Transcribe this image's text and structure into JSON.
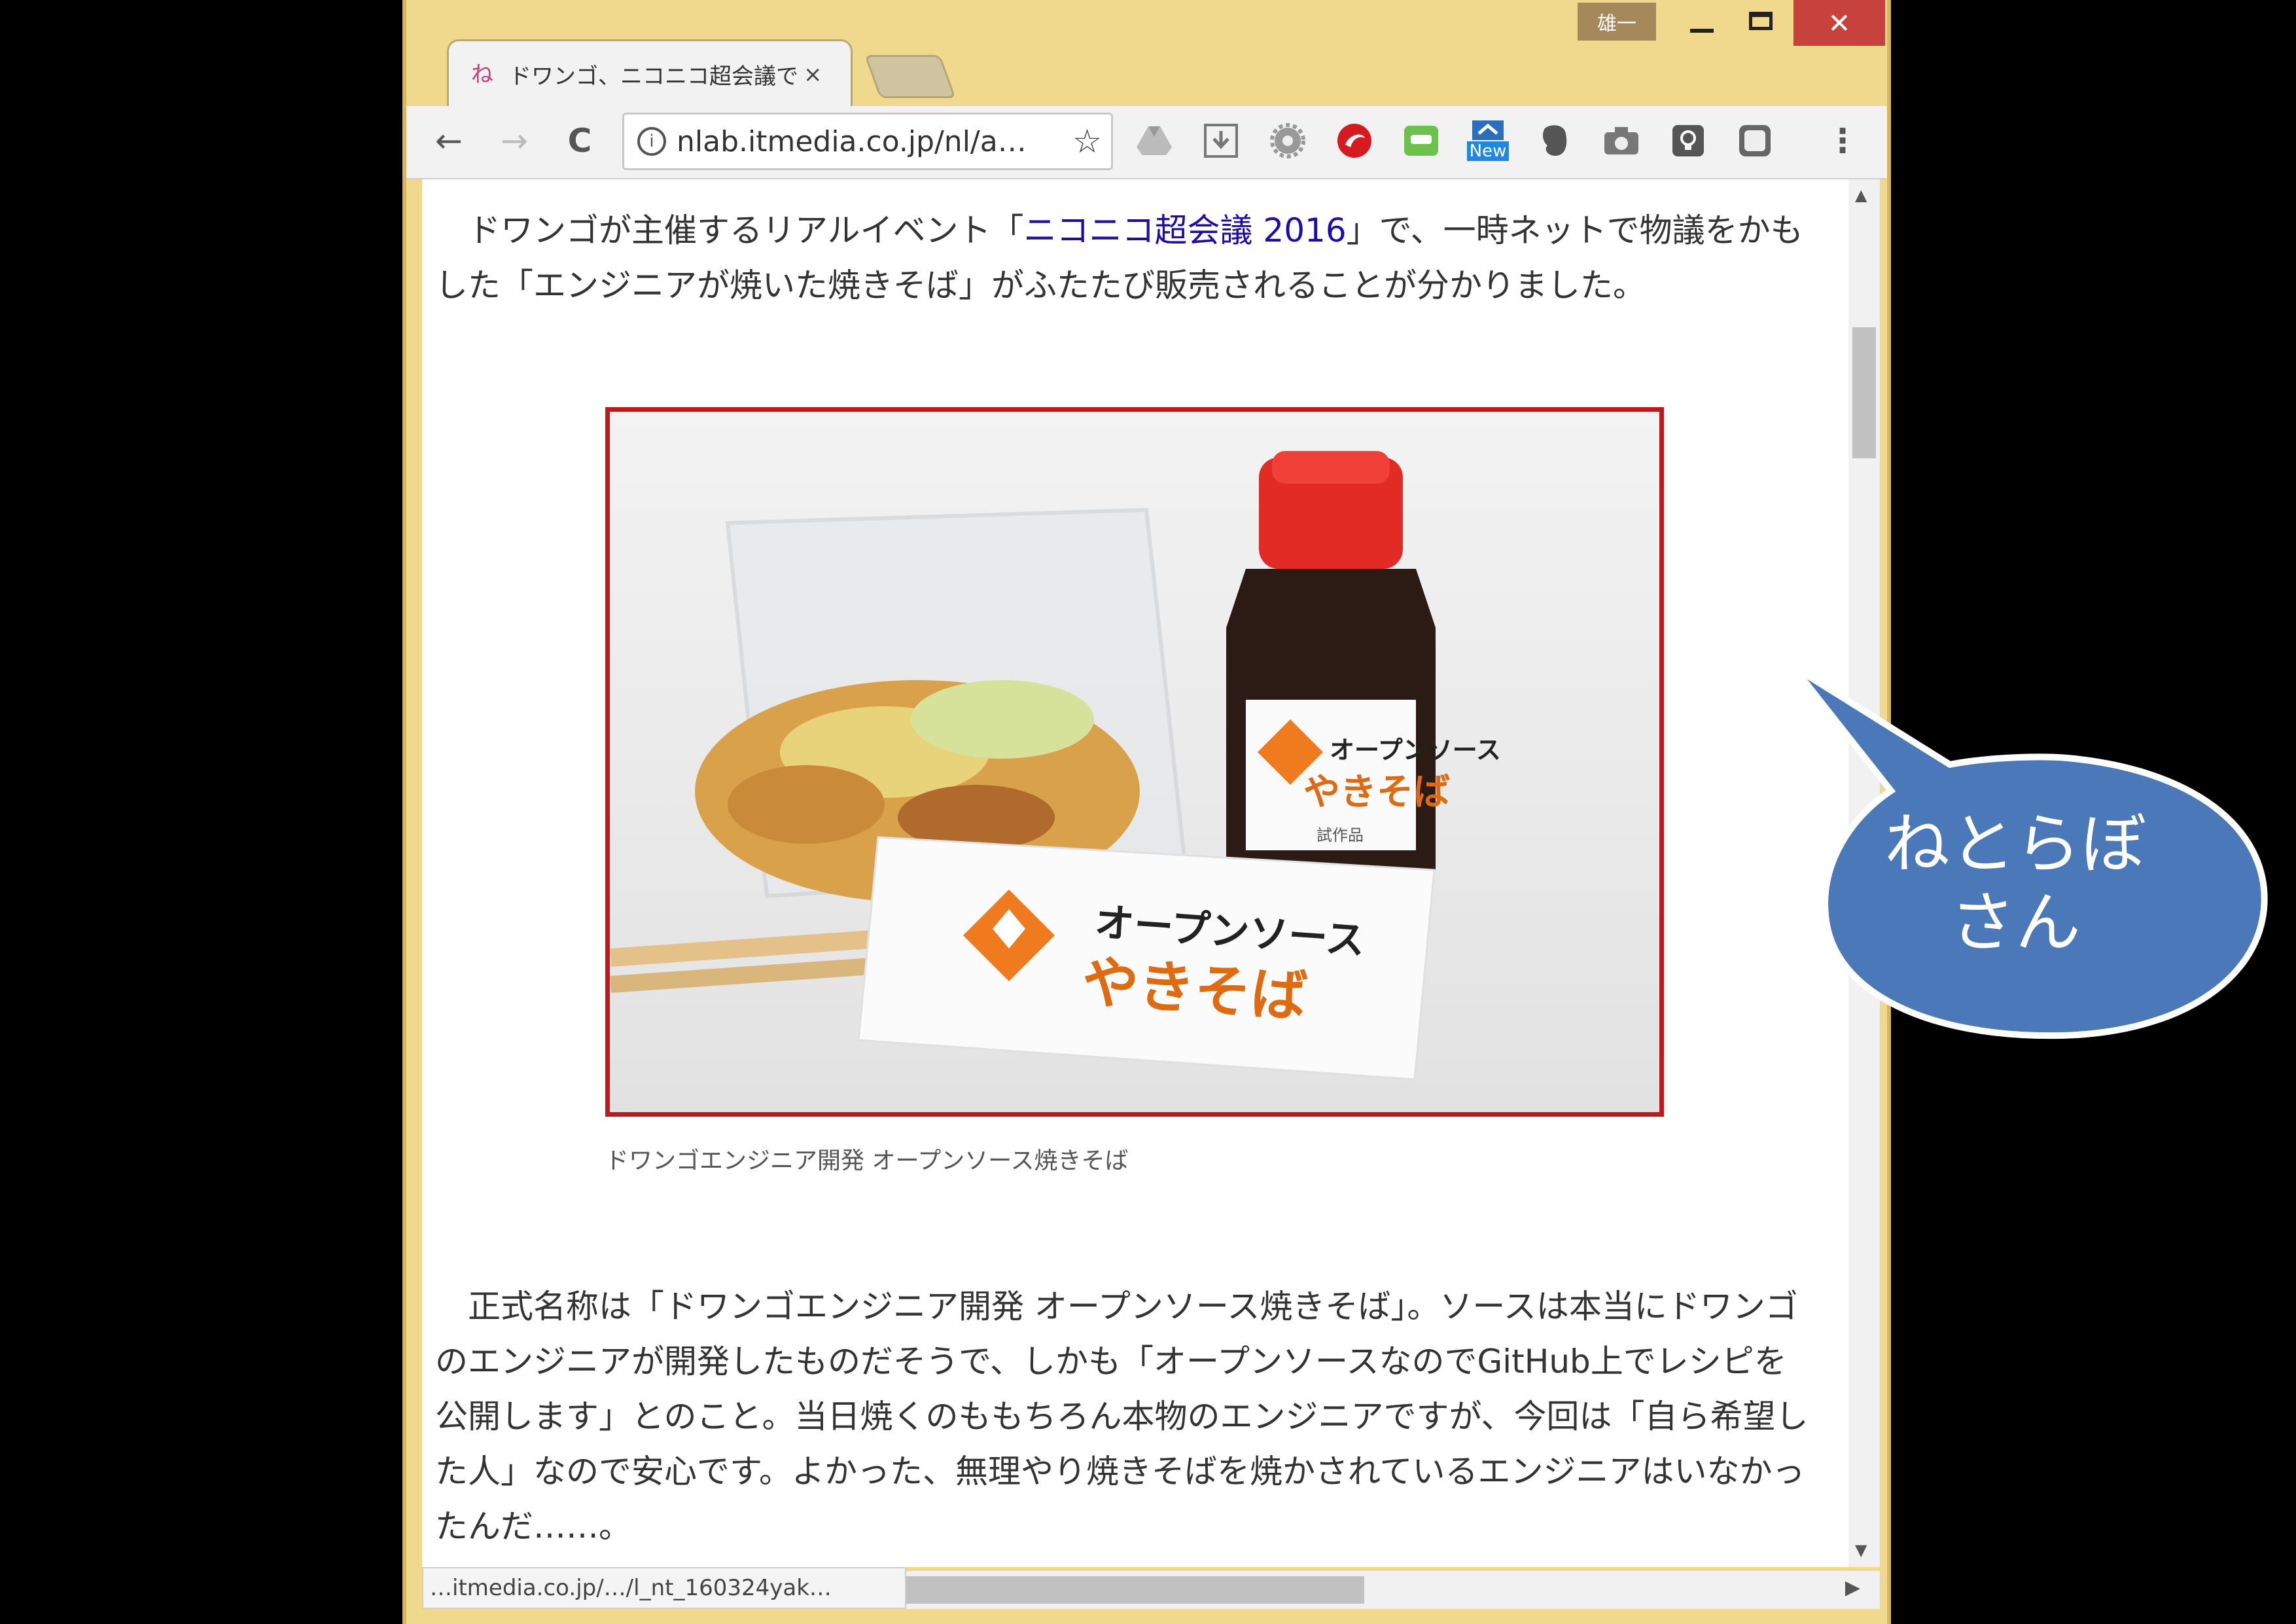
{
  "window": {
    "user_badge": "雄一",
    "close_glyph": "✕"
  },
  "tab": {
    "favicon_glyph": "ね",
    "title": "ドワンゴ、ニコニコ超会議で「",
    "close_glyph": "×"
  },
  "toolbar": {
    "back_glyph": "←",
    "forward_glyph": "→",
    "reload_glyph": "C",
    "info_glyph": "i",
    "url": "nlab.itmedia.co.jp/nl/a…",
    "star_glyph": "☆",
    "menu_glyph": "⋮",
    "new_badge": "New",
    "extensions": [
      "drive-icon",
      "download-icon",
      "settings-gear-icon",
      "trend-micro-icon",
      "line-icon",
      "new-extension-icon",
      "evernote-icon",
      "camera-icon",
      "lightbulb-icon",
      "square-extension-icon"
    ]
  },
  "article": {
    "para1_pre": "　ドワンゴが主催するリアルイベント「",
    "para1_link": "ニコニコ超会議 2016",
    "para1_post": "」で、一時ネットで物議をかもした「エンジニアが焼いた焼きそば」がふたたび販売されることが分かりました。",
    "photo_label_top": "オープンソース",
    "photo_label_bottom": "やきそば",
    "bottle_label_top": "オープンソース",
    "bottle_label_bottom": "やきそば",
    "bottle_small": "試作品",
    "caption": "ドワンゴエンジニア開発 オープンソース焼きそば",
    "para2": "　正式名称は「ドワンゴエンジニア開発 オープンソース焼きそば」。ソースは本当にドワンゴのエンジニアが開発したものだそうで、しかも「オープンソースなのでGitHub上でレシピを公開します」とのこと。当日焼くのももちろん本物のエンジニアですが、今回は「自ら希望した人」なので安心です。よかった、無理やり焼きそばを焼かされているエンジニアはいなかったんだ……。"
  },
  "status": {
    "url": "…itmedia.co.jp/…/l_nt_160324yak…"
  },
  "callout": {
    "line1": "ねとらぼ",
    "line2": "さん"
  },
  "colors": {
    "window_frame": "#f0d98c",
    "close_button": "#c7423c",
    "link": "#1a0dab",
    "photo_border": "#c0191c",
    "bubble_fill": "#4a78b8",
    "logo_orange": "#f07a1e"
  }
}
